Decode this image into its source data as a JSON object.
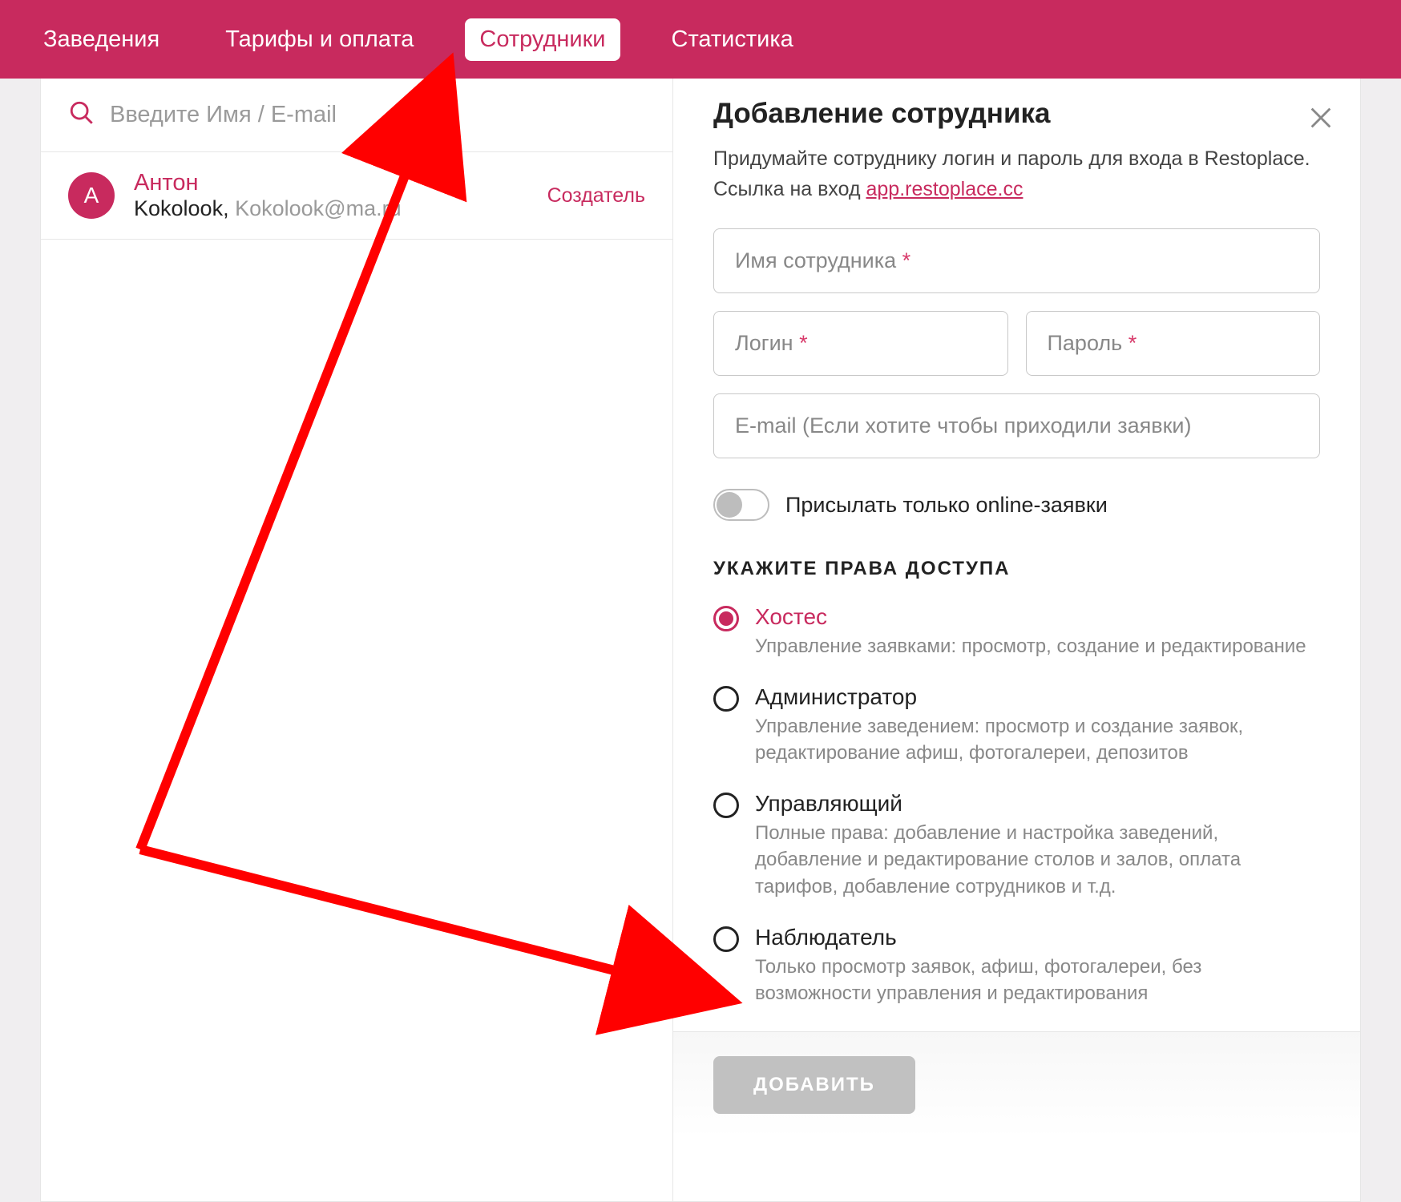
{
  "nav": {
    "tabs": [
      "Заведения",
      "Тарифы и оплата",
      "Сотрудники",
      "Статистика"
    ],
    "active_index": 2
  },
  "search": {
    "placeholder": "Введите Имя / E-mail"
  },
  "employee": {
    "avatar_letter": "А",
    "name": "Антон",
    "org": "Kokolook,",
    "email": "Kokolook@ma",
    "email_suffix": ".ru",
    "role": "Создатель"
  },
  "panel": {
    "title": "Добавление сотрудника",
    "desc_prefix": "Придумайте сотруднику логин и пароль для входа в Restoplace. Ссылка на вход ",
    "link": "app.restoplace.cc",
    "fields": {
      "name_label": "Имя сотрудника ",
      "login_label": "Логин ",
      "password_label": "Пароль ",
      "email_placeholder": "E-mail (Если хотите чтобы приходили заявки)",
      "required_mark": "*"
    },
    "toggle_label": "Присылать только online-заявки",
    "rights_header": "УКАЖИТЕ ПРАВА ДОСТУПА",
    "roles": [
      {
        "title": "Хостес",
        "desc": "Управление заявками: просмотр, создание и редактирование",
        "selected": true
      },
      {
        "title": "Администратор",
        "desc": "Управление заведением: просмотр и создание заявок, редактирование афиш, фотогалереи, депозитов",
        "selected": false
      },
      {
        "title": "Управляющий",
        "desc": "Полные права: добавление и настройка заведений, добавление и редактирование столов и залов, оплата тарифов, добавление сотрудников и т.д.",
        "selected": false
      },
      {
        "title": "Наблюдатель",
        "desc": "Только просмотр заявок, афиш, фотогалереи, без возможности управления и редактирования",
        "selected": false
      }
    ],
    "add_button": "ДОБАВИТЬ"
  }
}
